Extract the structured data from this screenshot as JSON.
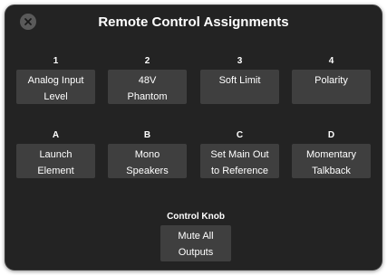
{
  "title": "Remote Control Assignments",
  "close_icon": "close-icon",
  "numbered_slots": [
    {
      "label": "1",
      "value": "Analog Input\nLevel"
    },
    {
      "label": "2",
      "value": "48V\nPhantom"
    },
    {
      "label": "3",
      "value": "Soft Limit"
    },
    {
      "label": "4",
      "value": "Polarity"
    }
  ],
  "lettered_slots": [
    {
      "label": "A",
      "value": "Launch\nElement"
    },
    {
      "label": "B",
      "value": "Mono\nSpeakers"
    },
    {
      "label": "C",
      "value": "Set Main Out\nto Reference"
    },
    {
      "label": "D",
      "value": "Momentary\nTalkback"
    }
  ],
  "control_knob": {
    "label": "Control Knob",
    "value": "Mute All\nOutputs"
  },
  "colors": {
    "panel_background": "#232323",
    "button_background": "#3f3f3f",
    "text": "#ffffff",
    "close_button": "#5a5a5a"
  }
}
